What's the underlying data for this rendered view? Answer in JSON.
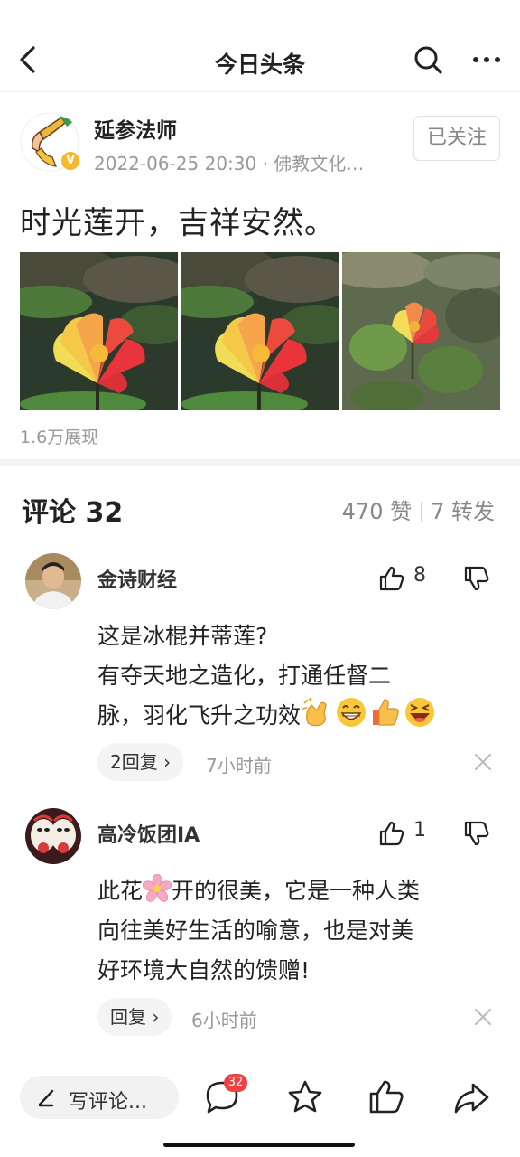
{
  "nav": {
    "title": "今日头条",
    "back_icon": "back-arrow-icon",
    "search_icon": "search-icon",
    "more_icon": "more-dots-icon"
  },
  "author": {
    "name": "延参法师",
    "meta": "2022-06-25 20:30 · 佛教文化…",
    "verified_icon": "verified-badge-icon",
    "follow_label": "已关注"
  },
  "post": {
    "text": "时光莲开，吉祥安然。",
    "images": [
      "lotus-photo",
      "lotus-photo",
      "lotus-photo"
    ],
    "impressions": "1.6万展现"
  },
  "comments_header": {
    "title": "评论 32",
    "likes": "470 赞",
    "shares": "7 转发"
  },
  "comments": [
    {
      "name": "金诗财经",
      "like_count": "8",
      "line1": "这是冰棍并蒂莲?",
      "line2": "有夺天地之造化，打通任督二",
      "line3": "脉，羽化飞升之功效",
      "emojis": [
        "applause-emoji",
        "grin-emoji",
        "thumbs-up-emoji",
        "laughing-emoji"
      ],
      "reply_label": "2回复 ›",
      "time": "7小时前"
    },
    {
      "name": "高冷饭团IA",
      "like_count": "1",
      "line1_before": "此花",
      "line1_after": "开的很美，它是一种人类",
      "line2": "向往美好生活的喻意，也是对美",
      "line3": "好环境大自然的馈赠!",
      "inline_icon": "cherry-blossom-emoji",
      "reply_label": "回复 ›",
      "time": "6小时前"
    }
  ],
  "bottom_bar": {
    "write_label": "写评论...",
    "comment_badge": "32",
    "comment_icon": "comment-bubble-icon",
    "favorite_icon": "star-icon",
    "like_icon": "thumbs-up-icon",
    "share_icon": "share-icon"
  },
  "colors": {
    "badge_red": "#f04142",
    "verified_gold": "#f5b82e",
    "meta_gray": "#999999"
  }
}
